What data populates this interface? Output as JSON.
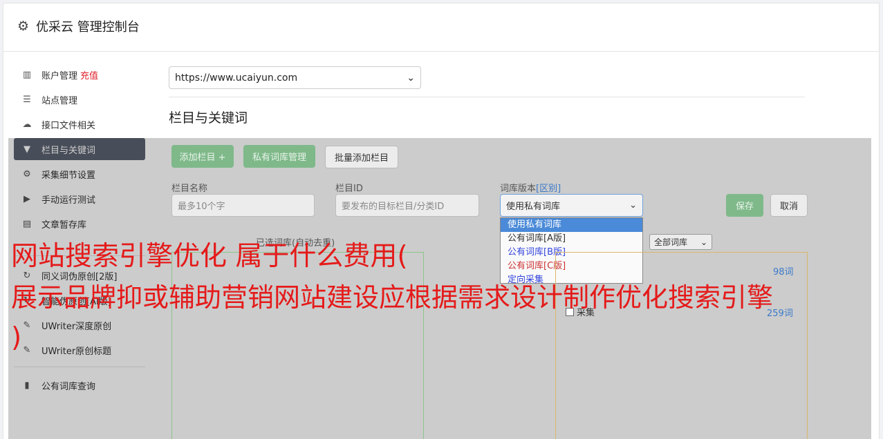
{
  "header": {
    "title": "优采云 管理控制台",
    "icon": "gear-icon"
  },
  "sidebar": {
    "items": [
      {
        "label": "账户管理",
        "badge": "充值",
        "icon": "bar-chart-icon"
      },
      {
        "label": "站点管理",
        "icon": "server-icon"
      },
      {
        "label": "接口文件相关",
        "icon": "cloud-upload-icon"
      },
      {
        "label": "栏目与关键词",
        "icon": "filter-icon",
        "active": true
      },
      {
        "label": "采集细节设置",
        "icon": "cogs-icon"
      },
      {
        "label": "手动运行测试",
        "icon": "play-circle-icon"
      },
      {
        "label": "文章暂存库",
        "icon": "database-icon"
      },
      {
        "label": "同义词伪原创[2版]",
        "icon": "refresh-icon"
      },
      {
        "label": "智能伪原创[AI版]",
        "icon": "refresh-icon"
      },
      {
        "label": "UWriter深度原创",
        "icon": "edit-icon"
      },
      {
        "label": "UWriter原创标题",
        "icon": "edit-icon"
      },
      {
        "label": "公有词库查询",
        "icon": "book-icon"
      }
    ]
  },
  "main": {
    "site_select": "https://www.ucaiyun.com",
    "section_title": "栏目与关键词",
    "buttons": {
      "add_column": "添加栏目 +",
      "private_lib": "私有词库管理",
      "batch_add": "批量添加栏目",
      "save": "保存",
      "cancel": "取消"
    },
    "form": {
      "name_label": "栏目名称",
      "name_placeholder": "最多10个字",
      "id_label": "栏目ID",
      "id_placeholder": "要发布的目标栏目/分类ID",
      "version_label": "词库版本",
      "version_diff": "[区别]",
      "version_value": "使用私有词库",
      "version_options": [
        "使用私有词库",
        "公有词库[A版]",
        "公有词库[B版]",
        "公有词库[C版]",
        "定向采集"
      ]
    },
    "selected_words_title": "已选词库(自动去重)",
    "lib_filter": "全部词库",
    "right_list": {
      "count1": "98词",
      "count2": "259词",
      "checkbox_label": "采集"
    }
  },
  "watermark": {
    "line1": "网站搜索引擎优化 属于什么费用(",
    "line2": "展示品牌抑或辅助营销网站建设应根据需求设计制作优化搜索引擎",
    "line3": ")"
  },
  "colors": {
    "active_nav": "#5a6270",
    "green": "#7fb98a",
    "watermark": "#e51a1a"
  }
}
